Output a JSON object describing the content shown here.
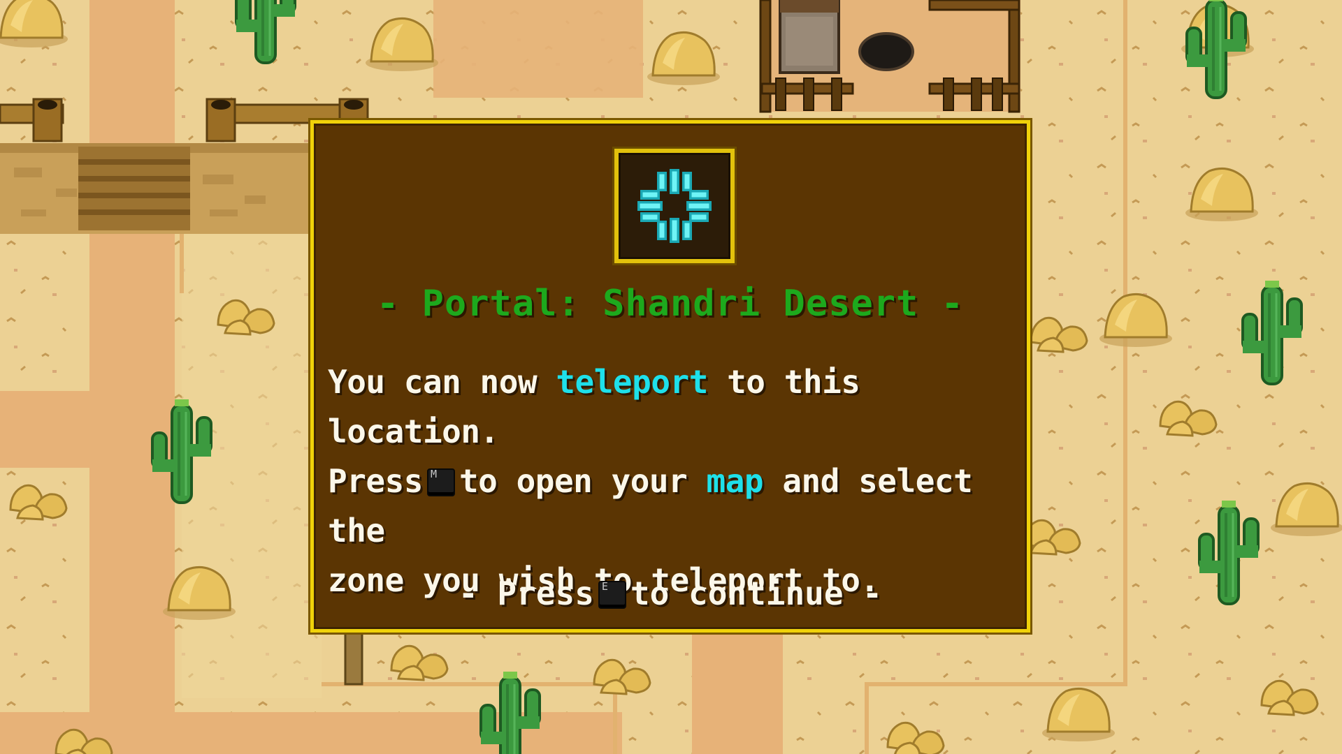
{
  "dialog": {
    "title": "- Portal: Shandri Desert -",
    "icon": "portal-rune-icon",
    "body": {
      "line1_pre": "You can now",
      "line1_hl": "teleport",
      "line1_post": "to this location.",
      "line2_pre": "Press",
      "line2_key": "M",
      "line2_mid": "to open your",
      "line2_hl": "map",
      "line2_post": "and select the",
      "line3": "zone you wish to teleport to."
    },
    "continue": {
      "pre": "- Press",
      "key": "E",
      "post": "to continue -"
    }
  },
  "colors": {
    "panel": "#5b3503",
    "border": "#f0d20a",
    "title": "#1da91d",
    "highlight": "#1ee0ea",
    "text": "#fbf7ea"
  }
}
